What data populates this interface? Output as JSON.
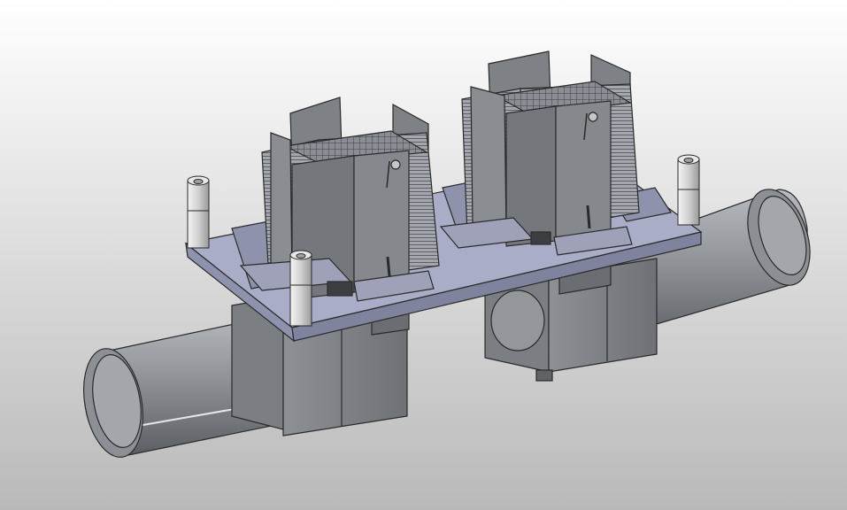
{
  "scene": {
    "background_top": "#ffffff",
    "background_bottom": "#b9b9b9",
    "plate_color": "#a9adc8",
    "metal_color": "#8e9196",
    "dark_metal_color": "#6c6f74",
    "fin_color": "#9fa2a8",
    "bolt_color": "#d6d6d6",
    "edge_color": "#2a2a2a"
  },
  "icons": [
    "cad-assembly-icon"
  ]
}
